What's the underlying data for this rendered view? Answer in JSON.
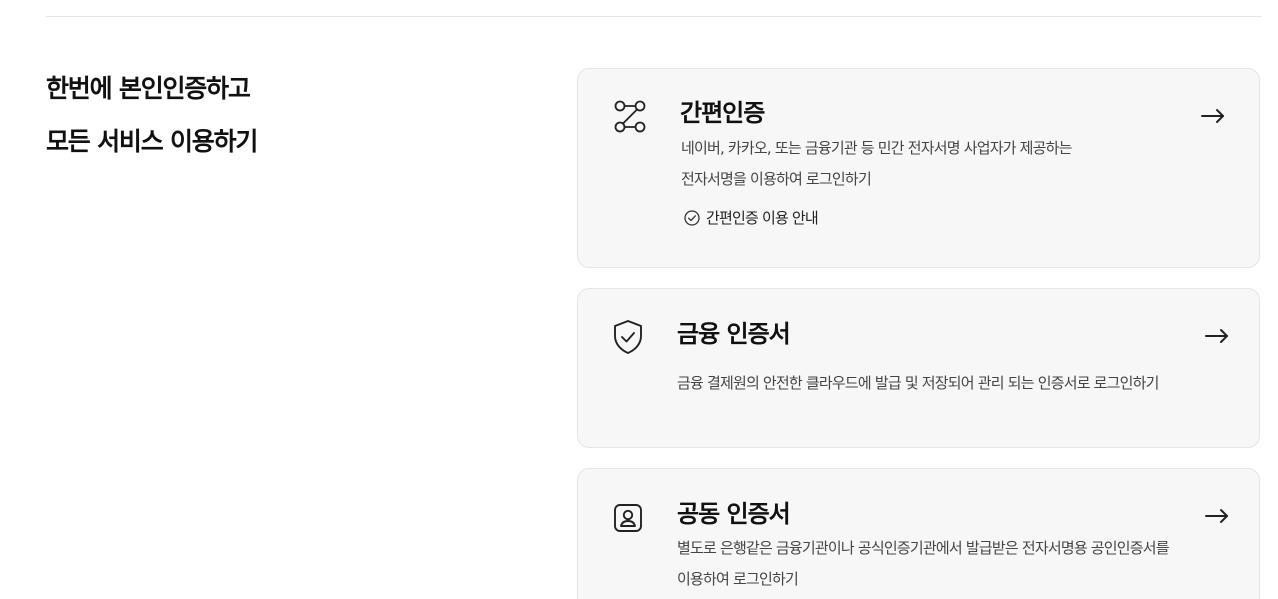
{
  "headline": {
    "line1": "한번에 본인인증하고",
    "line2": "모든 서비스 이용하기"
  },
  "cards": [
    {
      "title": "간편인증",
      "desc_line1": "네이버, 카카오, 또는 금융기관 등 민간 전자서명 사업자가 제공하는",
      "desc_line2": "전자서명을 이용하여 로그인하기",
      "guide_label": "간편인증 이용 안내",
      "icon": "route-nodes-icon",
      "arrow": "→"
    },
    {
      "title": "금융 인증서",
      "desc_line1": "금융 결제원의 안전한 클라우드에 발급 및 저장되어 관리 되는 인증서로 로그인하기",
      "icon": "shield-check-icon",
      "arrow": "→"
    },
    {
      "title": "공동 인증서",
      "desc_line1": "별도로 은행같은 금융기관이나 공식인증기관에서 발급받은 전자서명용 공인인증서를",
      "desc_line2": "이용하여 로그인하기",
      "icon": "user-badge-icon",
      "arrow": "→"
    }
  ],
  "colors": {
    "card_bg": "#f7f7f7",
    "card_border": "#e5e5e5",
    "text_primary": "#111111",
    "text_secondary": "#444444",
    "divider": "#e6e6e6"
  }
}
